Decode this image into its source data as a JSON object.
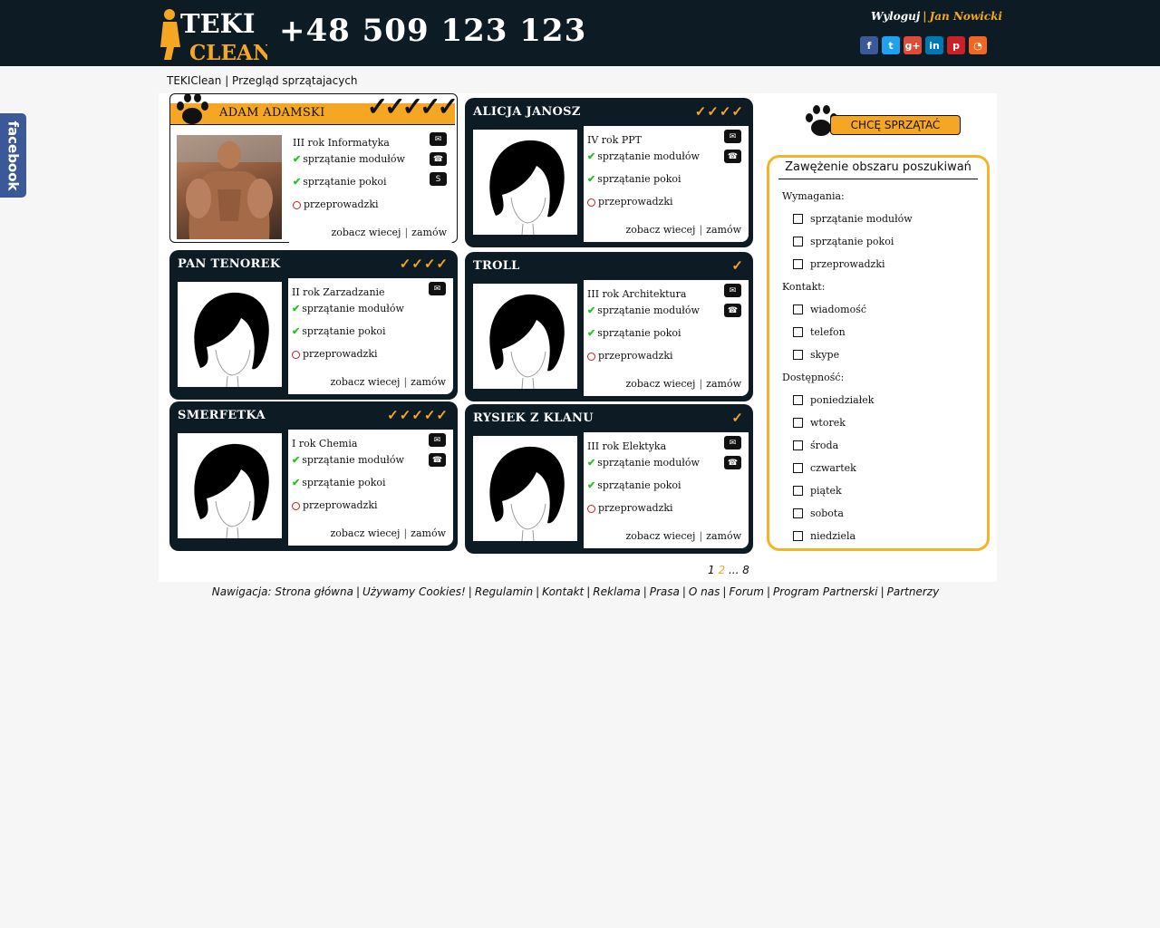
{
  "header": {
    "logo_top": "TEKI",
    "logo_bottom": "CLEAN",
    "phone": "+48 509 123 123",
    "logout": "Wyloguj",
    "separator": "|",
    "username": "Jan Nowicki",
    "socials": [
      {
        "name": "facebook-icon",
        "glyph": "f",
        "color": "#3b5998"
      },
      {
        "name": "twitter-icon",
        "glyph": "t",
        "color": "#1da1f2"
      },
      {
        "name": "google-plus-icon",
        "glyph": "g+",
        "color": "#dd4b39"
      },
      {
        "name": "linkedin-icon",
        "glyph": "in",
        "color": "#0077b5"
      },
      {
        "name": "pinterest-icon",
        "glyph": "p",
        "color": "#cb2027"
      },
      {
        "name": "rss-icon",
        "glyph": "◔",
        "color": "#f26522"
      }
    ]
  },
  "side_tab": {
    "label": "facebook"
  },
  "breadcrumb": "TEKIClean | Przegląd sprzątajacych",
  "cards": [
    {
      "name": "Adam Adamski",
      "checks": "✓✓✓✓✓",
      "year": "III rok Informatyka",
      "photo": "muscular-man",
      "icons": [
        "mail",
        "phone",
        "skype"
      ]
    },
    {
      "name": "Alicja Janosz",
      "checks": "✓✓✓✓",
      "year": "IV rok PPT",
      "photo": "silhouette",
      "icons": [
        "mail",
        "phone"
      ]
    },
    {
      "name": "Pan Tenorek",
      "checks": "✓✓✓✓",
      "year": "II rok Zarzadzanie",
      "photo": "silhouette",
      "icons": [
        "mail"
      ]
    },
    {
      "name": "Troll",
      "checks": "✓",
      "year": "III rok Architektura",
      "photo": "silhouette",
      "icons": [
        "mail",
        "phone"
      ]
    },
    {
      "name": "Smerfetka",
      "checks": "✓✓✓✓✓",
      "year": "I rok Chemia",
      "photo": "silhouette",
      "icons": [
        "mail",
        "phone"
      ]
    },
    {
      "name": "Rysiek z Klanu",
      "checks": "✓",
      "year": "III rok Elektyka",
      "photo": "silhouette",
      "icons": [
        "mail",
        "phone"
      ]
    }
  ],
  "card_labels": {
    "feature_modules": "sprzątanie modułów",
    "feature_rooms": "sprzątanie pokoi",
    "feature_moving": "przeprowadzki",
    "see_more": "zobacz wiecej",
    "order": "zamów",
    "pipe": "|"
  },
  "sidebar": {
    "want_button": "CHCĘ SPRZĄTAĆ",
    "filter_title": "Zawężenie obszaru poszukiwań",
    "sections": [
      {
        "label": "Wymagania:",
        "options": [
          "sprzątanie modułów",
          "sprzątanie pokoi",
          "przeprowadzki"
        ]
      },
      {
        "label": "Kontakt:",
        "options": [
          "wiadomość",
          "telefon",
          "skype"
        ]
      },
      {
        "label": "Dostępność:",
        "options": [
          "poniedziałek",
          "wtorek",
          "środa",
          "czwartek",
          "piątek",
          "sobota",
          "niedziela"
        ]
      }
    ]
  },
  "pagination": {
    "page1": "1",
    "page2": "2",
    "ellipsis": "...",
    "last": "8"
  },
  "footer": {
    "prefix": "Nawigacja:",
    "links": [
      "Strona główna",
      "Używamy Cookies!",
      "Regulamin",
      "Kontakt",
      "Reklama",
      "Prasa",
      "O nas",
      "Forum",
      "Program Partnerski",
      "Partnerzy"
    ]
  },
  "colors": {
    "accent": "#f5a623",
    "dark": "#0d1c24",
    "ok": "#24c31d",
    "no": "#d01818"
  }
}
